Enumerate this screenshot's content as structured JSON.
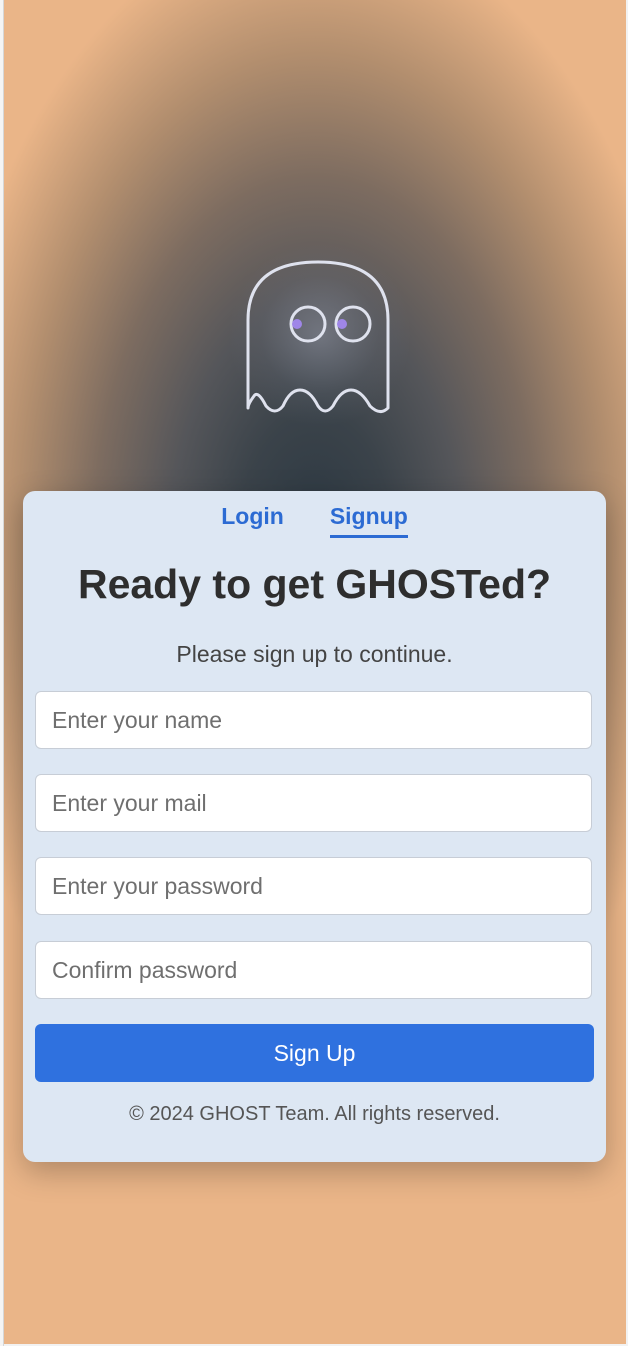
{
  "hero": {
    "icon": "ghost-icon"
  },
  "tabs": [
    {
      "label": "Login",
      "active": false
    },
    {
      "label": "Signup",
      "active": true
    }
  ],
  "form": {
    "title": "Ready to get GHOSTed?",
    "subtitle": "Please sign up to continue.",
    "fields": [
      {
        "placeholder": "Enter your name",
        "value": ""
      },
      {
        "placeholder": "Enter your mail",
        "value": ""
      },
      {
        "placeholder": "Enter your password",
        "value": ""
      },
      {
        "placeholder": "Confirm password",
        "value": ""
      }
    ],
    "submit_label": "Sign Up"
  },
  "footer": {
    "text": "© 2024 GHOST Team. All rights reserved."
  },
  "colors": {
    "accent": "#2f71df",
    "card": "#dde7f3",
    "title": "#2e2e2e"
  }
}
